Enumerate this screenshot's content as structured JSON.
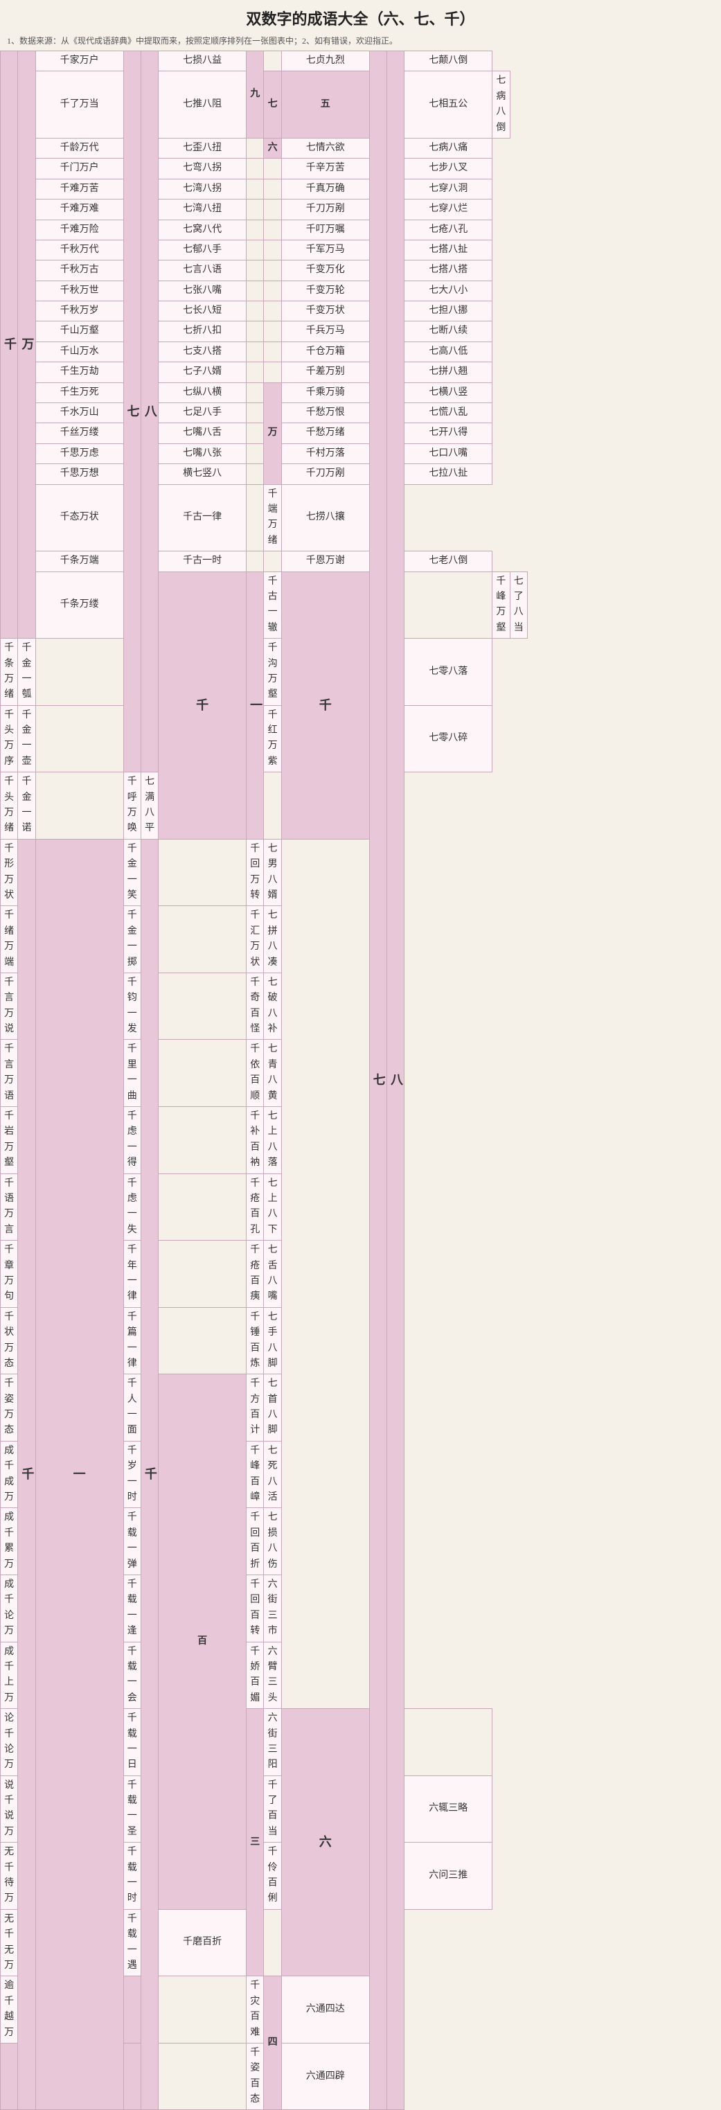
{
  "title": "双数字的成语大全（六、七、千）",
  "subtitle": "1、数据来源：从《现代成语辞典》中提取而来，按照定顺序排列在一张图表中；2、如有错误，欢迎指正。",
  "columns": {
    "col1_label": "千",
    "col2_label": "万",
    "col3_label": "七",
    "col4_label": "八",
    "col5_label": "九",
    "col6_label": "七",
    "col7_label": "万",
    "col8_label": "七",
    "col9_label": "八",
    "col10_label": "千",
    "col11_label": "一",
    "col12_label": "百",
    "col13_label": "六",
    "col14_label": "三",
    "col15_label": "四"
  },
  "rows": [
    {
      "c1": "千家万户",
      "c2": "",
      "c3": "七损八益",
      "c4": "九",
      "c5": "七贞九烈",
      "c6": "",
      "c7": "七颠八倒"
    },
    {
      "c1": "千了万当",
      "c2": "",
      "c3": "七推八阻",
      "c4": "七",
      "c5": "五",
      "c6": "七相五公",
      "c7": "七病八倒"
    },
    {
      "c1": "千龄万代",
      "c2": "",
      "c3": "七歪八扭",
      "c4": "",
      "c5": "六",
      "c6": "七情六欲",
      "c7": "七病八痛"
    },
    {
      "c1": "千门万户",
      "c2": "",
      "c3": "七弯八拐",
      "c4": "",
      "c5": "",
      "c6": "千辛万苦",
      "c7": "七步八叉"
    },
    {
      "c1": "千难万苦",
      "c2": "",
      "c3": "七湾八拐",
      "c4": "",
      "c5": "",
      "c6": "千真万确",
      "c7": "七穿八洞"
    },
    {
      "c1": "千难万难",
      "c2": "",
      "c3": "七湾八扭",
      "c4": "",
      "c5": "",
      "c6": "千刀万剐",
      "c7": "七穿八烂"
    },
    {
      "c1": "千难万险",
      "c2": "",
      "c3": "七窝八代",
      "c4": "",
      "c5": "",
      "c6": "千叮万嘱",
      "c7": "七疮八孔"
    },
    {
      "c1": "千秋万代",
      "c2": "",
      "c3": "七郁八手",
      "c4": "",
      "c5": "",
      "c6": "千军万马",
      "c7": "七搭八扯"
    },
    {
      "c1": "千秋万古",
      "c2": "",
      "c3": "七言八语",
      "c4": "",
      "c5": "",
      "c6": "千变万化",
      "c7": "七搭八搭"
    },
    {
      "c1": "千秋万世",
      "c2": "七",
      "c3": "八",
      "c4": "七张八嘴",
      "c5": "",
      "c6": "千变万轮",
      "c7": "七大八小"
    },
    {
      "c1": "千秋万岁",
      "c2": "",
      "c3": "七长八短",
      "c4": "",
      "c5": "",
      "c6": "千变万状",
      "c7": "七担八挪"
    },
    {
      "c1": "千山万壑",
      "c2": "",
      "c3": "七折八扣",
      "c4": "",
      "c5": "",
      "c6": "千兵万马",
      "c7": "七断八续"
    },
    {
      "c1": "千山万水",
      "c2": "",
      "c3": "七支八搭",
      "c4": "",
      "c5": "",
      "c6": "千仓万箱",
      "c7": "七高八低"
    },
    {
      "c1": "千生万劫",
      "c2": "",
      "c3": "七子八婿",
      "c4": "",
      "c5": "",
      "c6": "千差万别",
      "c7": "七拼八翘"
    },
    {
      "c1": "千生万死",
      "c2": "",
      "c3": "七纵八横",
      "c4": "",
      "c5": "万",
      "c6": "千乘万骑",
      "c7": "七横八竖"
    },
    {
      "c1": "千水万山",
      "c2": "",
      "c3": "七足八手",
      "c4": "",
      "c5": "",
      "c6": "千愁万恨",
      "c7": "七慌八乱"
    },
    {
      "c1": "千丝万缕",
      "c2": "",
      "c3": "七嘴八舌",
      "c4": "",
      "c5": "",
      "c6": "千愁万绪",
      "c7": "七开八得"
    },
    {
      "c1": "千思万虑",
      "c2": "",
      "c3": "七嘴八张",
      "c4": "",
      "c5": "",
      "c6": "千村万落",
      "c7": "七口八嘴"
    },
    {
      "c1": "千思万想",
      "c2": "",
      "c3": "横七竖八",
      "c4": "",
      "c5": "",
      "c6": "千刀万剐",
      "c7": "七拉八扯"
    },
    {
      "c1": "千态万状",
      "c2": "",
      "c3": "千古一律",
      "c4": "",
      "c5": "",
      "c6": "千端万绪",
      "c7": "七捞八攘"
    },
    {
      "c1": "千条万端",
      "c2": "",
      "c3": "千古一时",
      "c4": "",
      "c5": "",
      "c6": "千恩万谢",
      "c7": "七老八倒"
    },
    {
      "c1": "千",
      "c2": "万",
      "c3": "千条万缕",
      "c4": "",
      "c5": "",
      "c6": "千峰万壑",
      "c7": "七了八当"
    },
    {
      "c1": "千条万绪",
      "c2": "",
      "c3": "千古一辙",
      "c4": "千",
      "c5": "",
      "c6": "千沟万壑",
      "c7": "七零八落"
    },
    {
      "c1": "千头万序",
      "c2": "",
      "c3": "千金一瓠",
      "c4": "",
      "c5": "",
      "c6": "千红万紫",
      "c7": "七零八碎"
    },
    {
      "c1": "千头万绪",
      "c2": "",
      "c3": "千金一壶",
      "c4": "",
      "c5": "",
      "c6": "千呼万唤",
      "c7": "七满八平"
    },
    {
      "c1": "千形万状",
      "c2": "",
      "c3": "千金一诺",
      "c4": "",
      "c5": "",
      "c6": "千回万转",
      "c7": "七男八婿"
    },
    {
      "c1": "千绪万端",
      "c2": "",
      "c3": "千金一笑",
      "c4": "",
      "c5": "",
      "c6": "千汇万状",
      "c7": "七拼八凑"
    },
    {
      "c1": "千言万说",
      "c2": "",
      "c3": "千金一掷",
      "c4": "",
      "c5": "",
      "c6": "千奇百怪",
      "c7": "七破八补"
    },
    {
      "c1": "千言万语",
      "c2": "",
      "c3": "千钧一发",
      "c4": "",
      "c5": "",
      "c6": "千依百顺",
      "c7": "七青八黄"
    },
    {
      "c1": "千岩万壑",
      "c2": "",
      "c3": "千里一曲",
      "c4": "",
      "c5": "",
      "c6": "千补百衲",
      "c7": "七上八落"
    },
    {
      "c1": "千语万言",
      "c2": "千",
      "c3": "一",
      "c4": "千虑一得",
      "c5": "",
      "c6": "千疮百孔",
      "c7": "七上八下"
    },
    {
      "c1": "千章万句",
      "c2": "",
      "c3": "千虑一失",
      "c4": "",
      "c5": "",
      "c6": "千疮百痍",
      "c7": "七舌八嘴"
    },
    {
      "c1": "千状万态",
      "c2": "",
      "c3": "千年一律",
      "c4": "",
      "c5": "",
      "c6": "千锤百炼",
      "c7": "七手八脚"
    },
    {
      "c1": "千姿万态",
      "c2": "",
      "c3": "千篇一律",
      "c4": "",
      "c5": "",
      "c6": "千方百计",
      "c7": "七首八脚"
    },
    {
      "c1": "成千成万",
      "c2": "",
      "c3": "千人一面",
      "c4": "百",
      "c5": "",
      "c6": "千峰百嶂",
      "c7": "七死八活"
    },
    {
      "c1": "成千累万",
      "c2": "",
      "c3": "千岁一时",
      "c4": "",
      "c5": "",
      "c6": "千回百折",
      "c7": "七损八伤"
    },
    {
      "c1": "成千论万",
      "c2": "",
      "c3": "千载一弹",
      "c4": "",
      "c5": "",
      "c6": "千回百转",
      "c7": "六街三市"
    },
    {
      "c1": "成千上万",
      "c2": "",
      "c3": "千载一逢",
      "c4": "",
      "c5": "",
      "c6": "千娇百媚",
      "c7": "六臂三头"
    },
    {
      "c1": "论千论万",
      "c2": "",
      "c3": "千载一会",
      "c4": "",
      "c5": "三",
      "c6": "六街三阳",
      "c7": ""
    },
    {
      "c1": "说千说万",
      "c2": "",
      "c3": "千载一日",
      "c4": "六",
      "c5": "",
      "c6": "千了百当",
      "c7": "六辄三略"
    },
    {
      "c1": "无千待万",
      "c2": "",
      "c3": "千载一圣",
      "c4": "",
      "c5": "",
      "c6": "千伶百俐",
      "c7": "六问三推"
    },
    {
      "c1": "无千无万",
      "c2": "",
      "c3": "千载一时",
      "c4": "",
      "c5": "",
      "c6": "千磨百折",
      "c7": ""
    },
    {
      "c1": "逾千越万",
      "c2": "",
      "c3": "千载一遇",
      "c4": "",
      "c5": "",
      "c6": "千灾百难",
      "c7": "六通四达"
    },
    {
      "c1": "",
      "c2": "",
      "c3": "",
      "c4": "",
      "c5": "四",
      "c6": "千姿百态",
      "c7": "六通四辟"
    }
  ]
}
